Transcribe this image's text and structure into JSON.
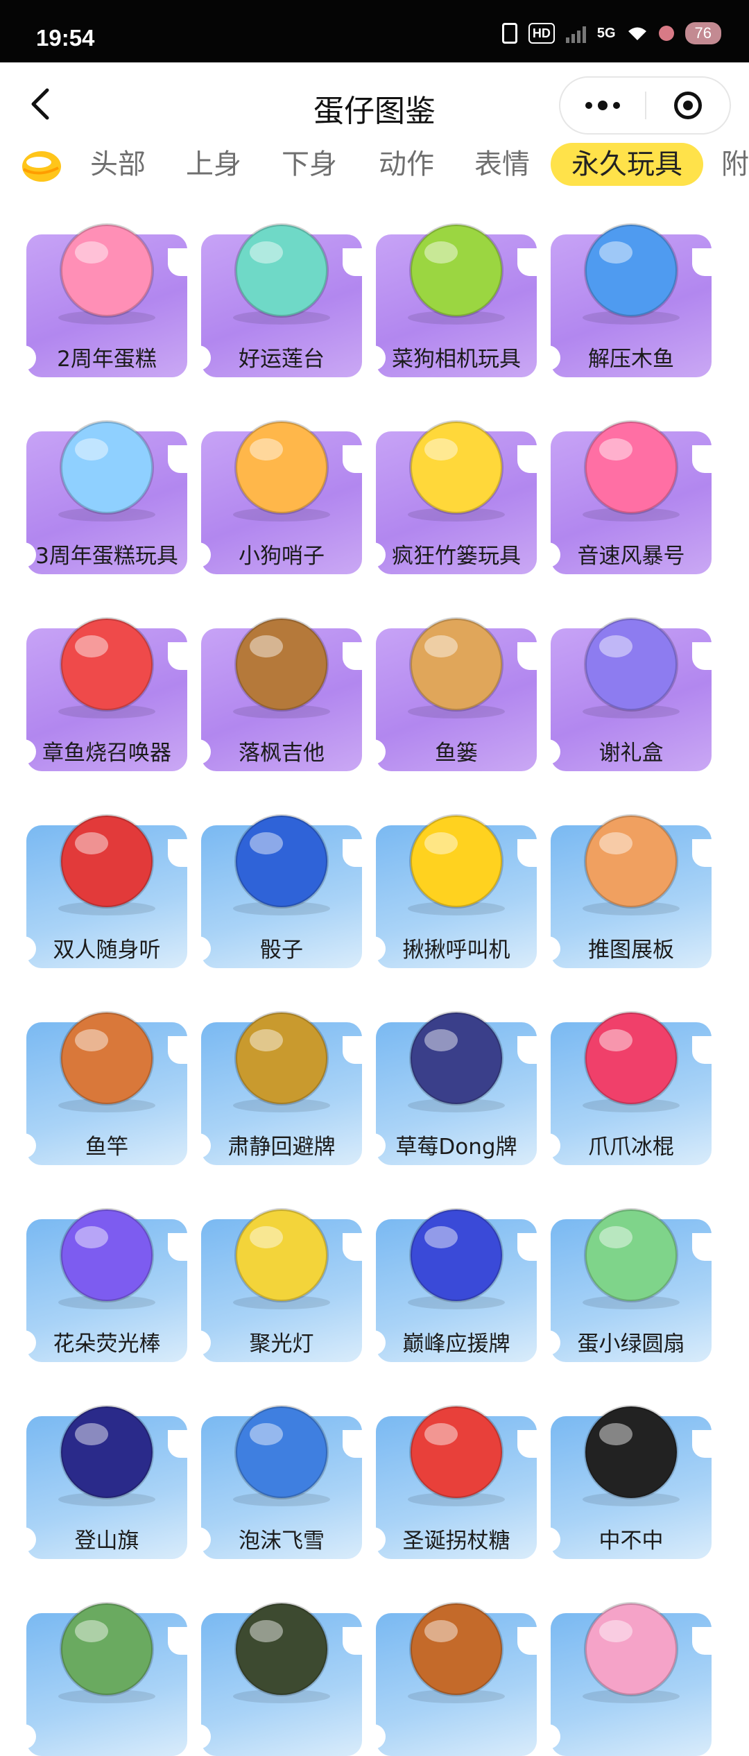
{
  "status_bar": {
    "time": "19:54",
    "hd_label": "HD",
    "network_label": "5G",
    "battery": "76"
  },
  "nav": {
    "title": "蛋仔图鉴"
  },
  "tabs": [
    "头部",
    "上身",
    "下身",
    "动作",
    "表情",
    "永久玩具",
    "附"
  ],
  "active_tab": "永久玩具",
  "items": [
    {
      "label": "2周年蛋糕",
      "theme": "purple"
    },
    {
      "label": "好运莲台",
      "theme": "purple"
    },
    {
      "label": "菜狗相机玩具",
      "theme": "purple"
    },
    {
      "label": "解压木鱼",
      "theme": "purple"
    },
    {
      "label": "3周年蛋糕玩具",
      "theme": "purple"
    },
    {
      "label": "小狗哨子",
      "theme": "purple"
    },
    {
      "label": "疯狂竹篓玩具",
      "theme": "purple"
    },
    {
      "label": "音速风暴号",
      "theme": "purple"
    },
    {
      "label": "章鱼烧召唤器",
      "theme": "purple"
    },
    {
      "label": "落枫吉他",
      "theme": "purple"
    },
    {
      "label": "鱼篓",
      "theme": "purple"
    },
    {
      "label": "谢礼盒",
      "theme": "purple"
    },
    {
      "label": "双人随身听",
      "theme": "blue"
    },
    {
      "label": "骰子",
      "theme": "blue"
    },
    {
      "label": "揪揪呼叫机",
      "theme": "blue"
    },
    {
      "label": "推图展板",
      "theme": "blue"
    },
    {
      "label": "鱼竿",
      "theme": "blue"
    },
    {
      "label": "肃静回避牌",
      "theme": "blue"
    },
    {
      "label": "草莓Dong牌",
      "theme": "blue"
    },
    {
      "label": "爪爪冰棍",
      "theme": "blue"
    },
    {
      "label": "花朵荧光棒",
      "theme": "blue"
    },
    {
      "label": "聚光灯",
      "theme": "blue"
    },
    {
      "label": "巅峰应援牌",
      "theme": "blue"
    },
    {
      "label": "蛋小绿圆扇",
      "theme": "blue"
    },
    {
      "label": "登山旗",
      "theme": "blue"
    },
    {
      "label": "泡沫飞雪",
      "theme": "blue"
    },
    {
      "label": "圣诞拐杖糖",
      "theme": "blue"
    },
    {
      "label": "中不中",
      "theme": "blue"
    },
    {
      "label": "",
      "theme": "blue"
    },
    {
      "label": "",
      "theme": "blue"
    },
    {
      "label": "",
      "theme": "blue"
    },
    {
      "label": "",
      "theme": "blue"
    }
  ]
}
